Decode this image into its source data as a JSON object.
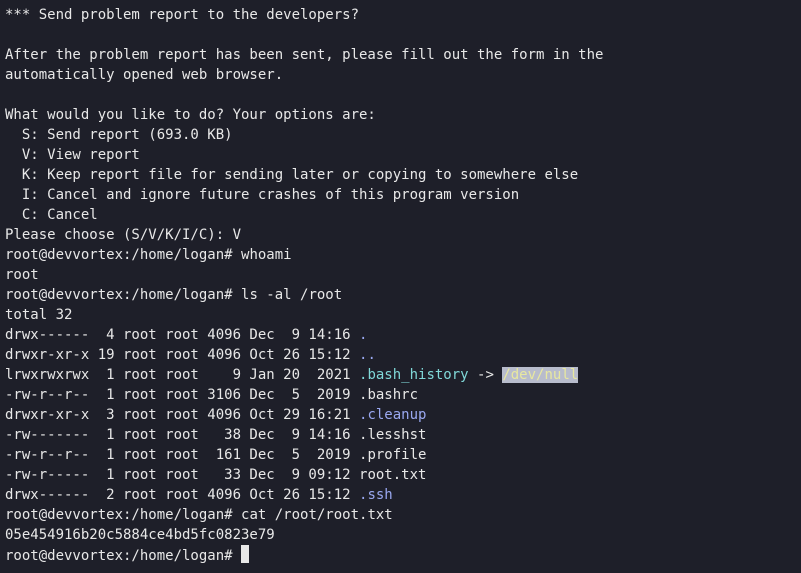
{
  "report": {
    "header": "*** Send problem report to the developers?",
    "info_line1": "After the problem report has been sent, please fill out the form in the",
    "info_line2": "automatically opened web browser.",
    "options_prompt": "What would you like to do? Your options are:",
    "options": [
      "  S: Send report (693.0 KB)",
      "  V: View report",
      "  K: Keep report file for sending later or copying to somewhere else",
      "  I: Cancel and ignore future crashes of this program version",
      "  C: Cancel"
    ],
    "choose": "Please choose (S/V/K/I/C): V"
  },
  "session": {
    "prompt": "root@devvortex:/home/logan# ",
    "cmd_whoami": "whoami",
    "out_whoami": "root",
    "cmd_ls": "ls -al /root",
    "out_total": "total 32",
    "listing": [
      {
        "meta": "drwx------  4 root root 4096 Dec  9 14:16 ",
        "name": "."
      },
      {
        "meta": "drwxr-xr-x 19 root root 4096 Oct 26 15:12 ",
        "name": ".."
      },
      {
        "meta": "lrwxrwxrwx  1 root root    9 Jan 20  2021 ",
        "name": ".bash_history",
        "arrow": " -> ",
        "target": "/dev/null"
      },
      {
        "meta": "-rw-r--r--  1 root root 3106 Dec  5  2019 ",
        "name": ".bashrc"
      },
      {
        "meta": "drwxr-xr-x  3 root root 4096 Oct 29 16:21 ",
        "name": ".cleanup"
      },
      {
        "meta": "-rw-------  1 root root   38 Dec  9 14:16 ",
        "name": ".lesshst"
      },
      {
        "meta": "-rw-r--r--  1 root root  161 Dec  5  2019 ",
        "name": ".profile"
      },
      {
        "meta": "-rw-r-----  1 root root   33 Dec  9 09:12 ",
        "name": "root.txt"
      },
      {
        "meta": "drwx------  2 root root 4096 Oct 26 15:12 ",
        "name": ".ssh"
      }
    ],
    "cmd_cat": "cat /root/root.txt",
    "out_hash": "05e454916b20c5884ce4bd5fc0823e79"
  },
  "colors": {
    "background": "#1e1f29",
    "foreground": "#e8e8e8",
    "directory": "#9aa8f0",
    "symlink": "#80d8d8",
    "highlight": "#b8bccc"
  }
}
